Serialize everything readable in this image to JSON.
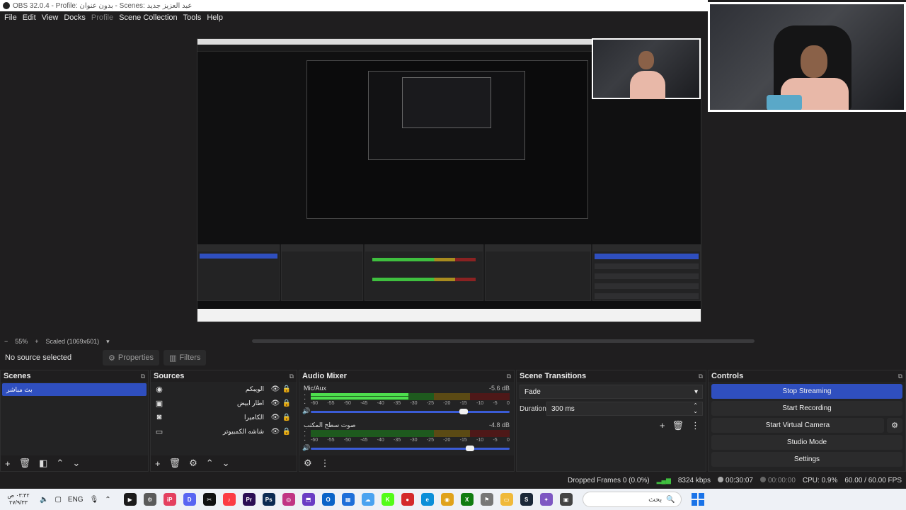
{
  "window": {
    "title": "OBS 32.0.4 - Profile: بدون عنوان - Scenes: عبد العزيز جديد"
  },
  "menu": {
    "items": [
      "File",
      "Edit",
      "View",
      "Docks",
      "Profile",
      "Scene Collection",
      "Tools",
      "Help"
    ],
    "disabled": [
      "Profile"
    ]
  },
  "zoom": {
    "minus": "−",
    "percent": "55%",
    "plus": "+",
    "scaled": "Scaled (1069x601)"
  },
  "source_toolbar": {
    "no_source": "No source selected",
    "properties_label": "Properties",
    "filters_label": "Filters"
  },
  "scenes": {
    "title": "Scenes",
    "items": [
      "بث مباشر"
    ]
  },
  "sources": {
    "title": "Sources",
    "items": [
      {
        "name": "الويبكم",
        "icon": "camera-icon"
      },
      {
        "name": "اطار ابيض",
        "icon": "image-icon"
      },
      {
        "name": "الكاميرا",
        "icon": "camera-icon"
      },
      {
        "name": "شاشه الكمبيوتر",
        "icon": "monitor-icon"
      }
    ]
  },
  "audio_mixer": {
    "title": "Audio Mixer",
    "channels": [
      {
        "name": "Mic/Aux",
        "db": "-5.6 dB",
        "level": 0.49,
        "volume": 0.77
      },
      {
        "name": "صوت سطح المكتب",
        "db": "-4.8 dB",
        "level": 0.0,
        "volume": 0.8
      }
    ],
    "ticks": [
      "-60",
      "-55",
      "-50",
      "-45",
      "-40",
      "-35",
      "-30",
      "-25",
      "-20",
      "-15",
      "-10",
      "-5",
      "0"
    ]
  },
  "scene_transitions": {
    "title": "Scene Transitions",
    "transition": "Fade",
    "duration_label": "Duration",
    "duration_value": "300 ms"
  },
  "controls": {
    "title": "Controls",
    "stop_streaming": "Stop Streaming",
    "start_recording": "Start Recording",
    "start_virtual_camera": "Start Virtual Camera",
    "studio_mode": "Studio Mode",
    "settings": "Settings"
  },
  "status": {
    "dropped_frames": "Dropped Frames 0 (0.0%)",
    "bitrate": "8324 kbps",
    "stream_time": "00:30:07",
    "record_time": "00:00:00",
    "cpu": "CPU: 0.9%",
    "fps": "60.00 / 60.00 FPS"
  },
  "taskbar": {
    "clock_time": "٠٣:٣٢ ص",
    "clock_date": "٢٧/٩/٣٣",
    "lang": "ENG",
    "search_placeholder": "بحث",
    "apps": [
      {
        "name": "obs",
        "color": "#1b1b1b",
        "label": "▶"
      },
      {
        "name": "settings",
        "color": "#5a5a5a",
        "label": "⚙"
      },
      {
        "name": "app-pink",
        "color": "#e4405f",
        "label": "iP"
      },
      {
        "name": "discord",
        "color": "#5865f2",
        "label": "D"
      },
      {
        "name": "capcut",
        "color": "#111",
        "label": "✂"
      },
      {
        "name": "itunes",
        "color": "#fc3c44",
        "label": "♪"
      },
      {
        "name": "premiere",
        "color": "#2a0d53",
        "label": "Pr"
      },
      {
        "name": "photoshop",
        "color": "#0b2a52",
        "label": "Ps"
      },
      {
        "name": "instagram",
        "color": "#c13584",
        "label": "◎"
      },
      {
        "name": "app-purple",
        "color": "#6a3dc4",
        "label": "⬒"
      },
      {
        "name": "outlook",
        "color": "#0a64c8",
        "label": "O"
      },
      {
        "name": "app-blue",
        "color": "#1e6fd9",
        "label": "▦"
      },
      {
        "name": "cloud",
        "color": "#4aa3f0",
        "label": "☁"
      },
      {
        "name": "kick",
        "color": "#53fc18",
        "label": "K"
      },
      {
        "name": "app-red",
        "color": "#d42a2a",
        "label": "●"
      },
      {
        "name": "edge",
        "color": "#0c8fd8",
        "label": "e"
      },
      {
        "name": "chrome",
        "color": "#e0a21b",
        "label": "◉"
      },
      {
        "name": "xbox",
        "color": "#107c10",
        "label": "X"
      },
      {
        "name": "app-gray",
        "color": "#777",
        "label": "⚑"
      },
      {
        "name": "files",
        "color": "#f0b93a",
        "label": "▭"
      },
      {
        "name": "steam",
        "color": "#1b2838",
        "label": "S"
      },
      {
        "name": "copilot",
        "color": "#7e57c2",
        "label": "✦"
      },
      {
        "name": "app-dark",
        "color": "#444",
        "label": "▣"
      }
    ]
  },
  "colors": {
    "accent": "#2f4fbf",
    "panel_bg": "#232324",
    "window_bg": "#1f1e1f",
    "meter_green": "#4ddf4d"
  }
}
